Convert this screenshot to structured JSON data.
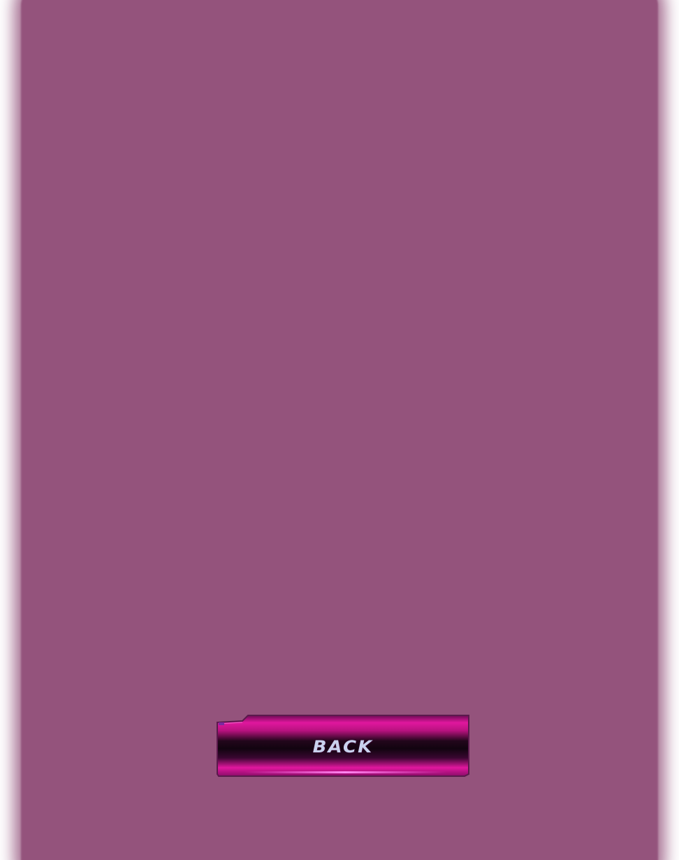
{
  "screen": {
    "background_color": "#94537c",
    "outer_color": "#ffffff"
  },
  "back_button": {
    "label": "BACK",
    "colors": {
      "magenta": "#e0179e",
      "dark": "#120410",
      "highlight": "#ff66e6",
      "text": "#c9d2ee"
    }
  }
}
